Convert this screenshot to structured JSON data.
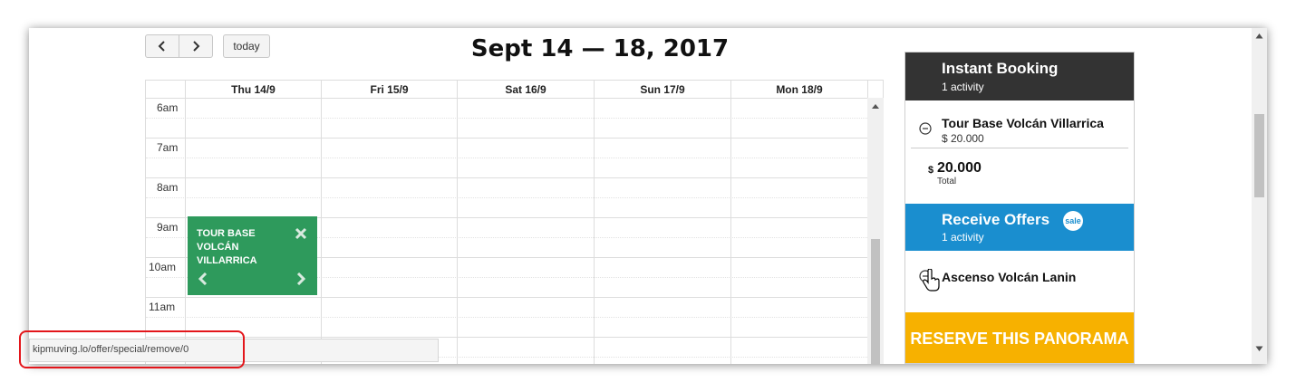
{
  "toolbar": {
    "prev_label": "‹",
    "next_label": "›",
    "today_label": "today"
  },
  "calendar": {
    "title": "Sept 14 — 18, 2017",
    "days": [
      "Thu 14/9",
      "Fri 15/9",
      "Sat 16/9",
      "Sun 17/9",
      "Mon 18/9"
    ],
    "times": [
      "6am",
      "7am",
      "8am",
      "9am",
      "10am",
      "11am"
    ],
    "event": {
      "title": "TOUR BASE VOLCÁN VILLARRICA",
      "color": "#2e9a5c"
    }
  },
  "panel": {
    "instant_booking": {
      "heading": "Instant Booking",
      "count": "1 activity",
      "item_name": "Tour Base Volcán Villarrica",
      "item_price": "$ 20.000",
      "total_currency": "$",
      "total_value": "20.000",
      "total_label": "Total",
      "color": "#333333"
    },
    "receive_offers": {
      "heading": "Receive Offers",
      "badge": "sale",
      "count": "1 activity",
      "item_name": "Ascenso Volcán Lanin",
      "color": "#1a8ecf"
    },
    "reserve_label": "RESERVE THIS PANORAMA",
    "reserve_color": "#f7b100"
  },
  "status_bar": {
    "url": "kipmuving.lo/offer/special/remove/0"
  },
  "annotation_color": "#e3161b"
}
